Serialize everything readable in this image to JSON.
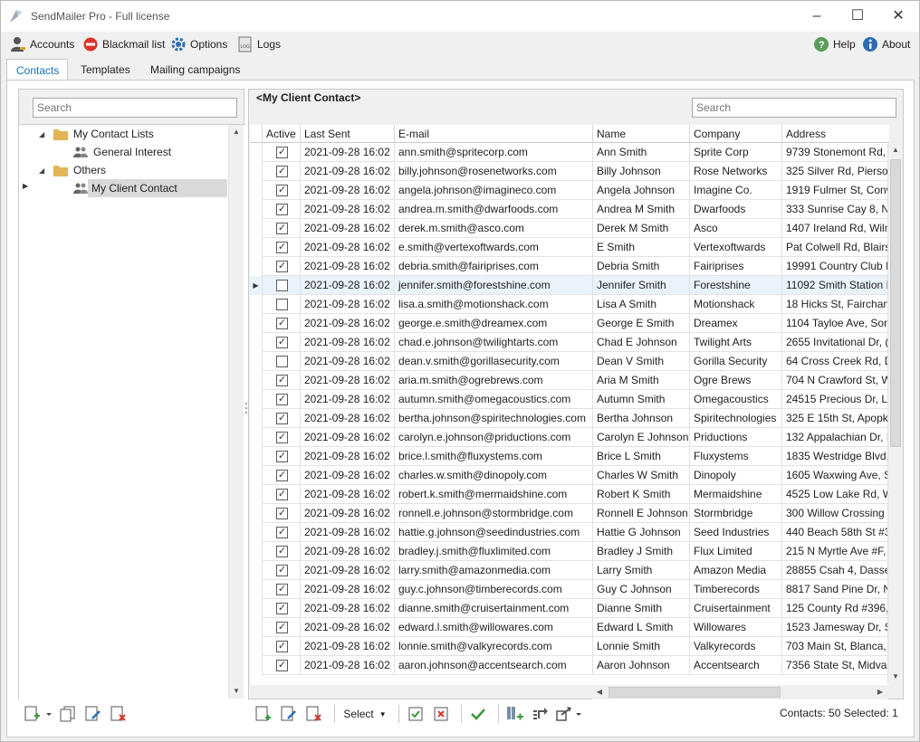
{
  "window": {
    "title": "SendMailer Pro - Full license"
  },
  "menu": {
    "accounts": "Accounts",
    "blackmail": "Blackmail list",
    "options": "Options",
    "logs": "Logs",
    "help": "Help",
    "about": "About"
  },
  "tabs": [
    "Contacts",
    "Templates",
    "Mailing campaigns"
  ],
  "left": {
    "search_placeholder": "Search",
    "tree": [
      {
        "label": "My Contact Lists",
        "type": "folder",
        "expanded": true
      },
      {
        "label": "General Interest",
        "type": "list"
      },
      {
        "label": "Others",
        "type": "folder",
        "expanded": true
      },
      {
        "label": "My Client Contact",
        "type": "list",
        "selected": true
      }
    ]
  },
  "right": {
    "group_title": "<My Client Contact>",
    "search_placeholder": "Search",
    "columns": [
      "Active",
      "Last Sent",
      "E-mail",
      "Name",
      "Company",
      "Address"
    ],
    "rows": [
      {
        "active": true,
        "last_sent": "2021-09-28 16:02",
        "email": "ann.smith@spritecorp.com",
        "name": "Ann Smith",
        "company": "Sprite Corp",
        "address": "9739 Stonemont Rd,"
      },
      {
        "active": true,
        "last_sent": "2021-09-28 16:02",
        "email": "billy.johnson@rosenetworks.com",
        "name": "Billy Johnson",
        "company": "Rose Networks",
        "address": "325 Silver Rd, Pierson"
      },
      {
        "active": true,
        "last_sent": "2021-09-28 16:02",
        "email": "angela.johnson@imagineco.com",
        "name": "Angela Johnson",
        "company": "Imagine Co.",
        "address": "1919 Fulmer St, Conw"
      },
      {
        "active": true,
        "last_sent": "2021-09-28 16:02",
        "email": "andrea.m.smith@dwarfoods.com",
        "name": "Andrea M Smith",
        "company": "Dwarfoods",
        "address": "333 Sunrise Cay 8, Na"
      },
      {
        "active": true,
        "last_sent": "2021-09-28 16:02",
        "email": "derek.m.smith@asco.com",
        "name": "Derek M Smith",
        "company": "Asco",
        "address": "1407 Ireland Rd, Wiln"
      },
      {
        "active": true,
        "last_sent": "2021-09-28 16:02",
        "email": "e.smith@vertexoftwards.com",
        "name": "E Smith",
        "company": "Vertexoftwards",
        "address": "Pat Colwell Rd, Blairsv"
      },
      {
        "active": true,
        "last_sent": "2021-09-28 16:02",
        "email": "debria.smith@fairiprises.com",
        "name": "Debria Smith",
        "company": "Fairiprises",
        "address": "19991 Country Club D"
      },
      {
        "active": false,
        "selected": true,
        "last_sent": "2021-09-28 16:02",
        "email": "jennifer.smith@forestshine.com",
        "name": "Jennifer Smith",
        "company": "Forestshine",
        "address": "11092 Smith Station I"
      },
      {
        "active": false,
        "last_sent": "2021-09-28 16:02",
        "email": "lisa.a.smith@motionshack.com",
        "name": "Lisa A Smith",
        "company": "Motionshack",
        "address": "18 Hicks St, Fairchanc"
      },
      {
        "active": true,
        "last_sent": "2021-09-28 16:02",
        "email": "george.e.smith@dreamex.com",
        "name": "George E Smith",
        "company": "Dreamex",
        "address": "1104 Tayloe Ave, Son"
      },
      {
        "active": true,
        "last_sent": "2021-09-28 16:02",
        "email": "chad.e.johnson@twilightarts.com",
        "name": "Chad E Johnson",
        "company": "Twilight Arts",
        "address": "2655 Invitational Dr, ("
      },
      {
        "active": false,
        "last_sent": "2021-09-28 16:02",
        "email": "dean.v.smith@gorillasecurity.com",
        "name": "Dean V Smith",
        "company": "Gorilla Security",
        "address": "64 Cross Creek Rd, Dc"
      },
      {
        "active": true,
        "last_sent": "2021-09-28 16:02",
        "email": "aria.m.smith@ogrebrews.com",
        "name": "Aria M Smith",
        "company": "Ogre Brews",
        "address": "704 N Crawford St, W"
      },
      {
        "active": true,
        "last_sent": "2021-09-28 16:02",
        "email": "autumn.smith@omegacoustics.com",
        "name": "Autumn Smith",
        "company": "Omegacoustics",
        "address": "24515 Precious Dr, Lo"
      },
      {
        "active": true,
        "last_sent": "2021-09-28 16:02",
        "email": "bertha.johnson@spiritechnologies.com",
        "name": "Bertha Johnson",
        "company": "Spiritechnologies",
        "address": "325 E 15th St, Apopk"
      },
      {
        "active": true,
        "last_sent": "2021-09-28 16:02",
        "email": "carolyn.e.johnson@priductions.com",
        "name": "Carolyn E Johnson",
        "company": "Priductions",
        "address": "132 Appalachian Dr, I"
      },
      {
        "active": true,
        "last_sent": "2021-09-28 16:02",
        "email": "brice.l.smith@fluxystems.com",
        "name": "Brice L Smith",
        "company": "Fluxystems",
        "address": "1835 Westridge Blvd,"
      },
      {
        "active": true,
        "last_sent": "2021-09-28 16:02",
        "email": "charles.w.smith@dinopoly.com",
        "name": "Charles W Smith",
        "company": "Dinopoly",
        "address": "1605 Waxwing Ave, S"
      },
      {
        "active": true,
        "last_sent": "2021-09-28 16:02",
        "email": "robert.k.smith@mermaidshine.com",
        "name": "Robert K Smith",
        "company": "Mermaidshine",
        "address": "4525 Low Lake Rd, W"
      },
      {
        "active": true,
        "last_sent": "2021-09-28 16:02",
        "email": "ronnell.e.johnson@stormbridge.com",
        "name": "Ronnell E Johnson",
        "company": "Stormbridge",
        "address": "300 Willow Crossing"
      },
      {
        "active": true,
        "last_sent": "2021-09-28 16:02",
        "email": "hattie.g.johnson@seedindustries.com",
        "name": "Hattie G Johnson",
        "company": "Seed Industries",
        "address": "440 Beach 58th St #3"
      },
      {
        "active": true,
        "last_sent": "2021-09-28 16:02",
        "email": "bradley.j.smith@fluxlimited.com",
        "name": "Bradley J Smith",
        "company": "Flux Limited",
        "address": "215 N Myrtle Ave #F,"
      },
      {
        "active": true,
        "last_sent": "2021-09-28 16:02",
        "email": "larry.smith@amazonmedia.com",
        "name": "Larry Smith",
        "company": "Amazon Media",
        "address": "28855 Csah 4, Dassel,"
      },
      {
        "active": true,
        "last_sent": "2021-09-28 16:02",
        "email": "guy.c.johnson@timberecords.com",
        "name": "Guy C Johnson",
        "company": "Timberecords",
        "address": "8817 Sand Pine Dr, N"
      },
      {
        "active": true,
        "last_sent": "2021-09-28 16:02",
        "email": "dianne.smith@cruisertainment.com",
        "name": "Dianne Smith",
        "company": "Cruisertainment",
        "address": "125 County Rd #396,"
      },
      {
        "active": true,
        "last_sent": "2021-09-28 16:02",
        "email": "edward.l.smith@willowares.com",
        "name": "Edward L Smith",
        "company": "Willowares",
        "address": "1523 Jamesway Dr, Sp"
      },
      {
        "active": true,
        "last_sent": "2021-09-28 16:02",
        "email": "lonnie.smith@valkyrecords.com",
        "name": "Lonnie Smith",
        "company": "Valkyrecords",
        "address": "703 Main St, Blanca, ("
      },
      {
        "active": true,
        "last_sent": "2021-09-28 16:02",
        "email": "aaron.johnson@accentsearch.com",
        "name": "Aaron Johnson",
        "company": "Accentsearch",
        "address": "7356 State St, Midval"
      }
    ]
  },
  "bottom": {
    "select_label": "Select",
    "status": "Contacts: 50 Selected: 1"
  },
  "colors": {
    "accent": "#1570b8",
    "selected_row": "#eaf3fb",
    "tree_selected": "#d9d9d9"
  }
}
